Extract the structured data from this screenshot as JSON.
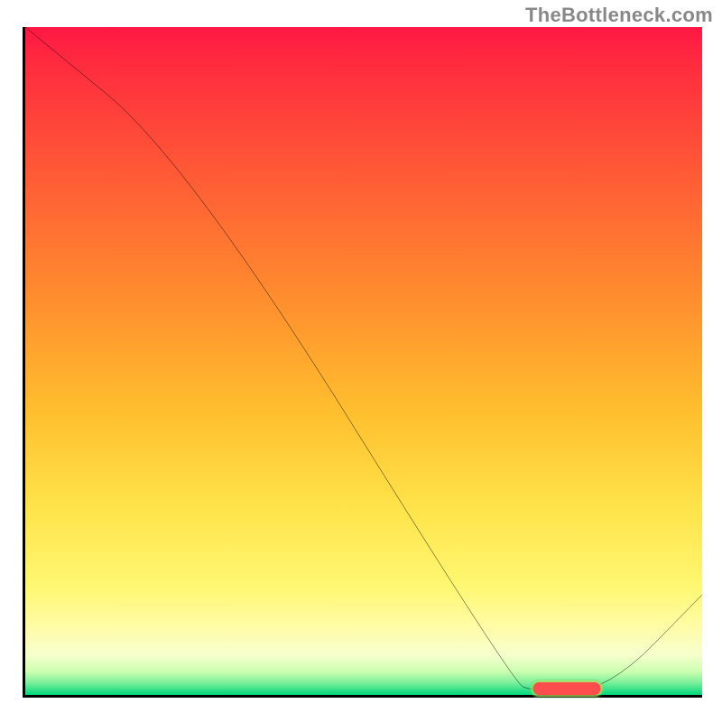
{
  "watermark": "TheBottleneck.com",
  "chart_data": {
    "type": "line",
    "title": "",
    "xlabel": "",
    "ylabel": "",
    "xlim": [
      0,
      100
    ],
    "ylim": [
      0,
      100
    ],
    "curve": [
      {
        "x": 0,
        "y": 100
      },
      {
        "x": 24,
        "y": 80
      },
      {
        "x": 72,
        "y": 2
      },
      {
        "x": 75,
        "y": 0.5
      },
      {
        "x": 86,
        "y": 0.5
      },
      {
        "x": 100,
        "y": 15
      }
    ],
    "background_gradient": [
      {
        "stop": 0.0,
        "color": "#ff1744"
      },
      {
        "stop": 0.05,
        "color": "#ff2a3f"
      },
      {
        "stop": 0.22,
        "color": "#ff5a36"
      },
      {
        "stop": 0.4,
        "color": "#ff8c2e"
      },
      {
        "stop": 0.58,
        "color": "#ffc02e"
      },
      {
        "stop": 0.72,
        "color": "#ffe34a"
      },
      {
        "stop": 0.84,
        "color": "#fff873"
      },
      {
        "stop": 0.9,
        "color": "#fffca8"
      },
      {
        "stop": 0.94,
        "color": "#f6ffcd"
      },
      {
        "stop": 0.965,
        "color": "#ccffb0"
      },
      {
        "stop": 0.982,
        "color": "#7aef9a"
      },
      {
        "stop": 1.0,
        "color": "#00d77a"
      }
    ],
    "marker_bar": {
      "x_center": 80,
      "width_pct": 10,
      "color": "#ff4c4c",
      "label": ""
    }
  }
}
